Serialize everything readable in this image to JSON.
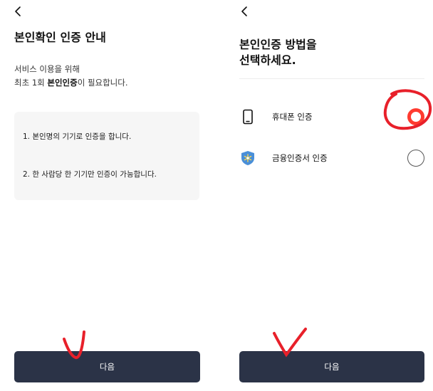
{
  "left_screen": {
    "back_icon": "chevron-left-icon",
    "title": "본인확인 인증 안내",
    "subtitle_line1": "서비스 이용을 위해",
    "subtitle_line2_prefix": "최초 1회 ",
    "subtitle_line2_bold": "본인인증",
    "subtitle_line2_suffix": "이 필요합니다.",
    "notices": [
      "1.  본인명의 기기로 인증을 합니다.",
      "2.  한 사람당 한 기기만 인증이 가능합니다."
    ],
    "next_button": "다음"
  },
  "right_screen": {
    "back_icon": "chevron-left-icon",
    "title_line1": "본인인증 방법을",
    "title_line2": "선택하세요.",
    "options": [
      {
        "label": "휴대폰 인증",
        "icon": "mobile-phone-icon",
        "selected": true
      },
      {
        "label": "금융인증서 인증",
        "icon": "financial-certificate-icon",
        "selected": false
      }
    ],
    "next_button": "다음"
  },
  "colors": {
    "button_bg": "#2b3347",
    "radio_selected": "#ff3b30",
    "annotation_red": "#e8202a",
    "notice_bg": "#f6f6f6",
    "cert_icon": "#4a8fd8"
  }
}
